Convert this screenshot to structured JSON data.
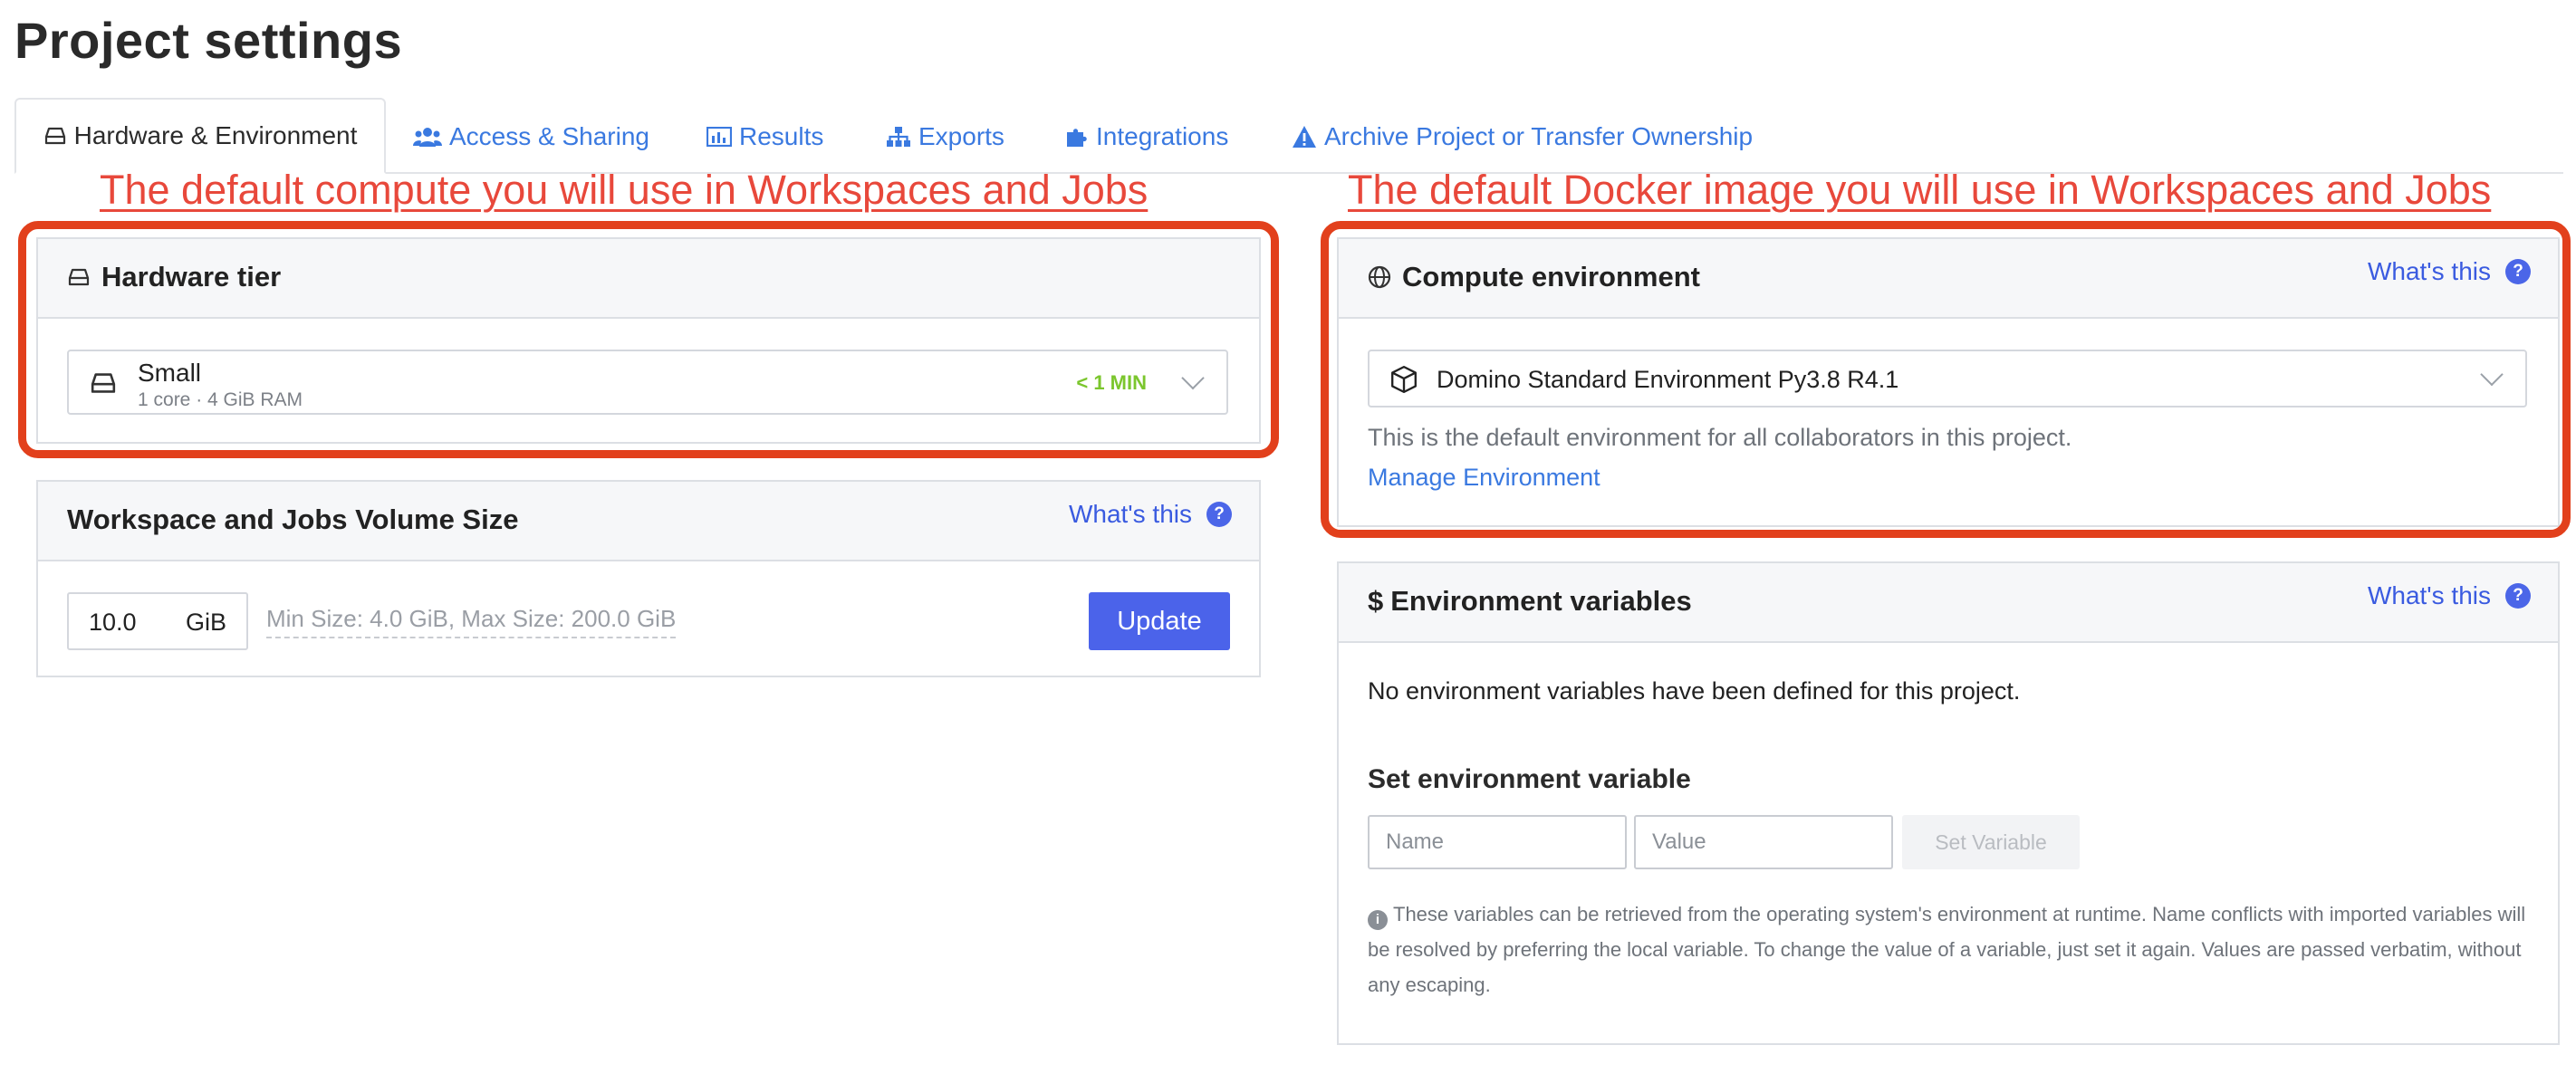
{
  "page": {
    "title": "Project settings"
  },
  "tabs": [
    {
      "label": "Hardware & Environment",
      "icon": "hard-drive-icon",
      "active": true
    },
    {
      "label": "Access & Sharing",
      "icon": "users-icon"
    },
    {
      "label": "Results",
      "icon": "bar-chart-icon"
    },
    {
      "label": "Exports",
      "icon": "sitemap-icon"
    },
    {
      "label": "Integrations",
      "icon": "puzzle-icon"
    },
    {
      "label": "Archive Project or Transfer Ownership",
      "icon": "warning-icon"
    }
  ],
  "annotations": {
    "left": "The default compute you will use in Workspaces and Jobs",
    "right": "The default Docker image you will use in Workspaces and Jobs"
  },
  "hardware": {
    "title": "Hardware tier",
    "tier_name": "Small",
    "tier_specs": "1 core · 4 GiB RAM",
    "startup_badge": "< 1 MIN"
  },
  "volume": {
    "title": "Workspace and Jobs Volume Size",
    "whats_this": "What's this",
    "value": "10.0",
    "unit": "GiB",
    "hint": "Min Size: 4.0 GiB, Max Size: 200.0 GiB",
    "update_label": "Update"
  },
  "compute_env": {
    "title": "Compute environment",
    "whats_this": "What's this",
    "selected": "Domino Standard Environment Py3.8 R4.1",
    "description": "This is the default environment for all collaborators in this project.",
    "manage_link": "Manage Environment"
  },
  "env_vars": {
    "title": "Environment variables",
    "dollar": "$",
    "whats_this": "What's this",
    "empty_message": "No environment variables have been defined for this project.",
    "set_heading": "Set environment variable",
    "name_placeholder": "Name",
    "value_placeholder": "Value",
    "set_button": "Set Variable",
    "note": "These variables can be retrieved from the operating system's environment at runtime. Name conflicts with imported variables will be resolved by preferring the local variable. To change the value of a variable, just set it again. Values are passed verbatim, without any escaping."
  },
  "colors": {
    "accent": "#4b63ea",
    "link": "#3a79e0",
    "annotation": "#e8483b",
    "highlight_box": "#e2401c",
    "badge_green": "#7bc62d"
  }
}
